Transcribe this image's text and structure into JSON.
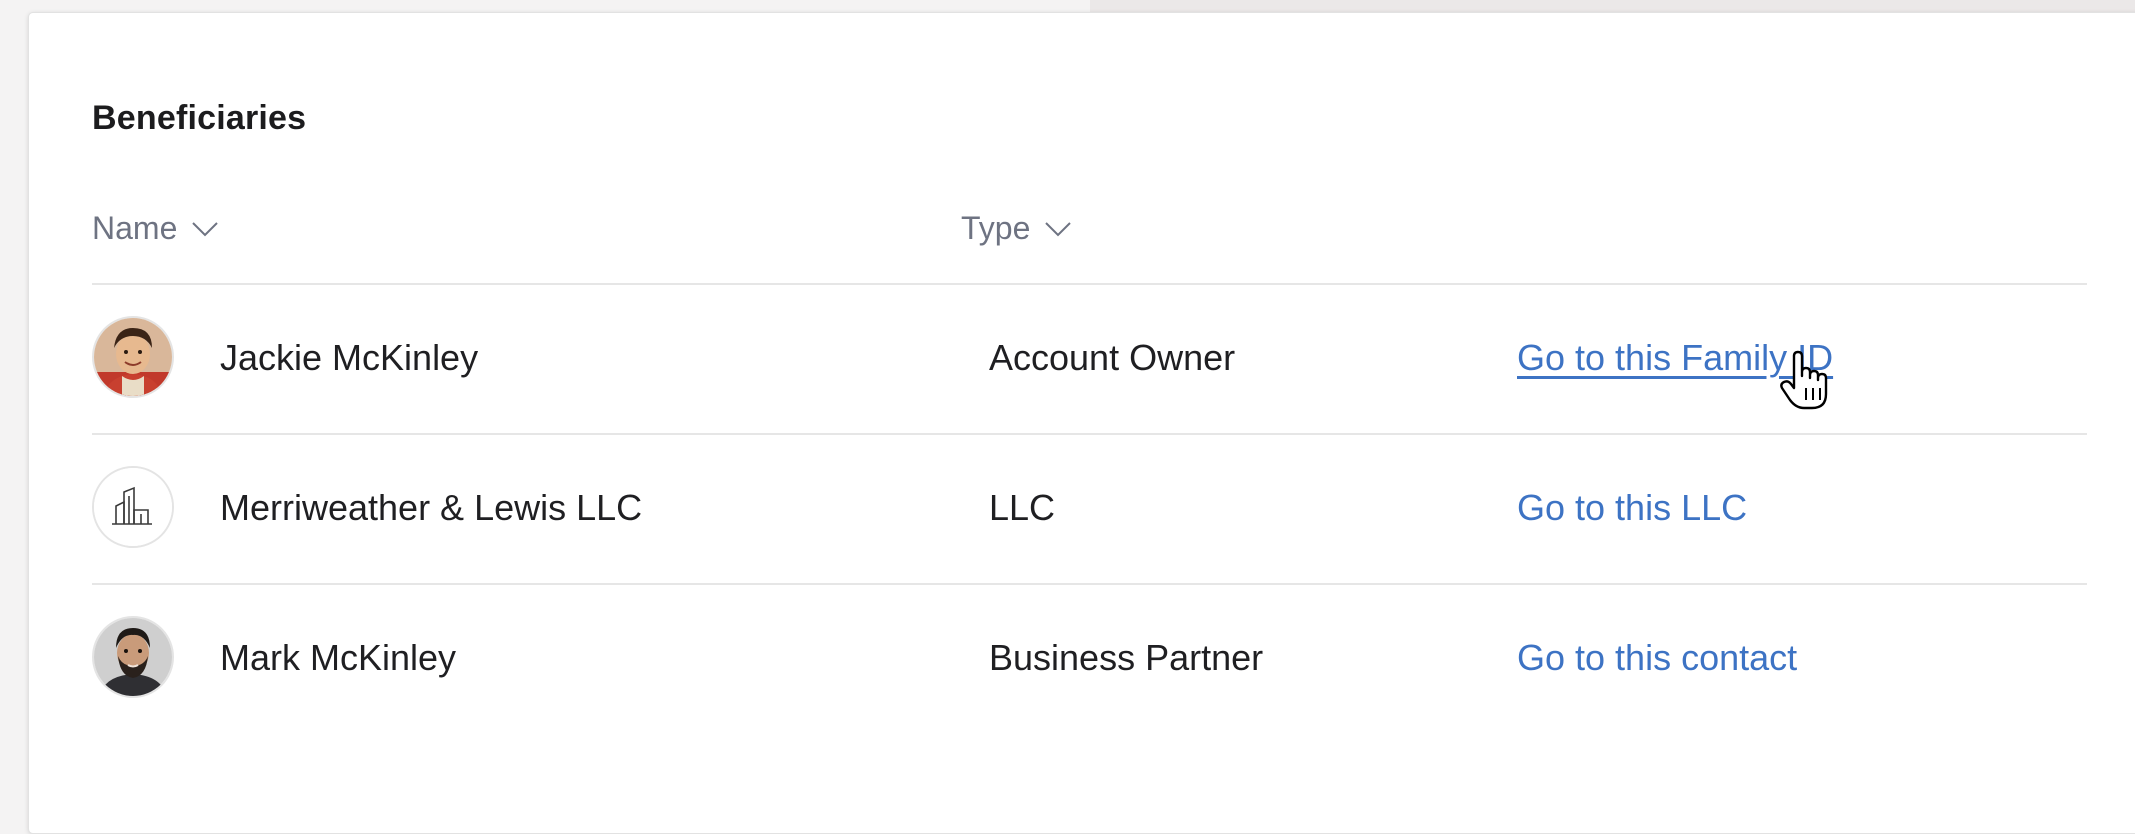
{
  "card": {
    "title": "Beneficiaries"
  },
  "columns": {
    "name_label": "Name",
    "type_label": "Type"
  },
  "rows": [
    {
      "name": "Jackie McKinley",
      "type": "Account Owner",
      "link": "Go to this Family ID",
      "avatar": "person-photo",
      "hovered": true
    },
    {
      "name": "Merriweather & Lewis LLC",
      "type": "LLC",
      "link": "Go to this LLC",
      "avatar": "building-icon",
      "hovered": false
    },
    {
      "name": "Mark McKinley",
      "type": "Business Partner",
      "link": "Go to this contact",
      "avatar": "person-photo",
      "hovered": false
    }
  ],
  "colors": {
    "link": "#3d73c4",
    "header_text": "#6e7382",
    "body_text": "#1f1f22"
  }
}
